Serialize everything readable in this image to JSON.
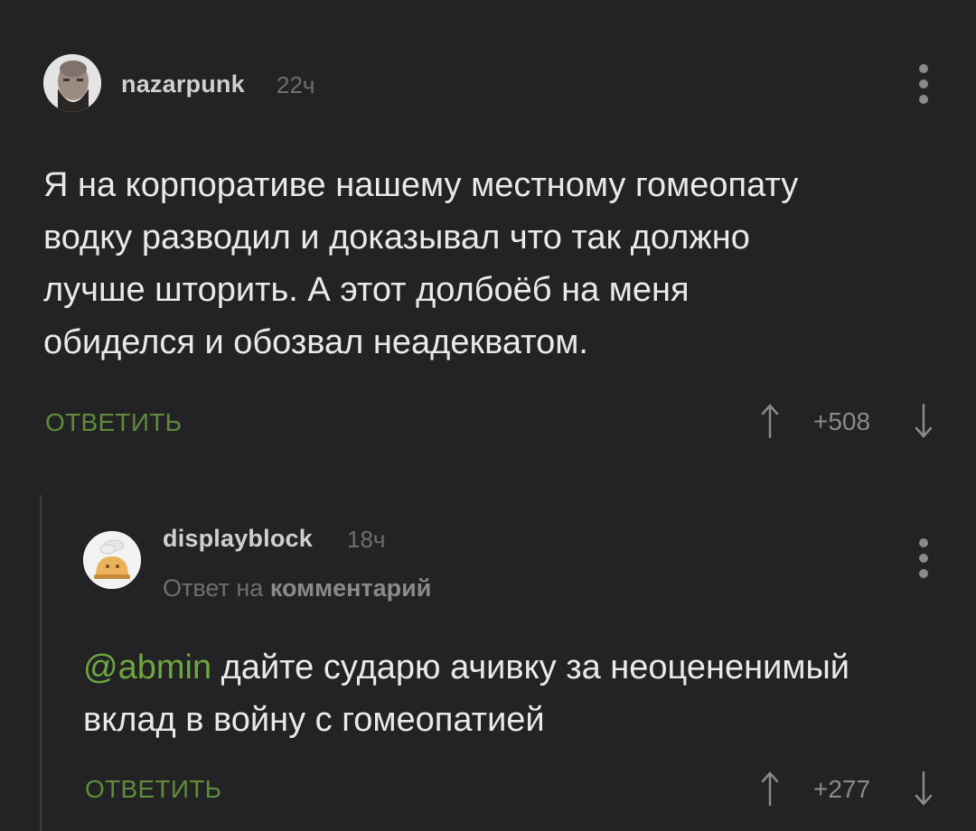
{
  "comments": [
    {
      "username": "nazarpunk",
      "time": "22ч",
      "text": "Я на корпоративе нашему местному гомеопату водку разводил и доказывал что так должно лучше шторить. А этот долбоёб на меня обиделся и обозвал неадекватом.",
      "lines": [
        "Я на корпоративе нашему местному гомеопату",
        "водку разводил и доказывал что так должно",
        "лучше шторить. А этот долбоёб на меня",
        "обиделся и обозвал неадекватом."
      ],
      "reply_label": "ОТВЕТИТЬ",
      "score": "+508"
    },
    {
      "username": "displayblock",
      "time": "18ч",
      "reply_to_prefix": "Ответ на",
      "reply_to_target": "комментарий",
      "mention": "@abmin",
      "line1_rest": " дайте сударю ачивку за неоцененимый",
      "line2": "вклад в войну с гомеопатией",
      "reply_label": "ОТВЕТИТЬ",
      "score": "+277"
    }
  ],
  "icons": {
    "upvote": "arrow-up-icon",
    "downvote": "arrow-down-icon",
    "menu": "more-vertical-icon"
  },
  "colors": {
    "background": "#232325",
    "accent_green": "#5f8b3a",
    "mention_green": "#6ea63f"
  }
}
